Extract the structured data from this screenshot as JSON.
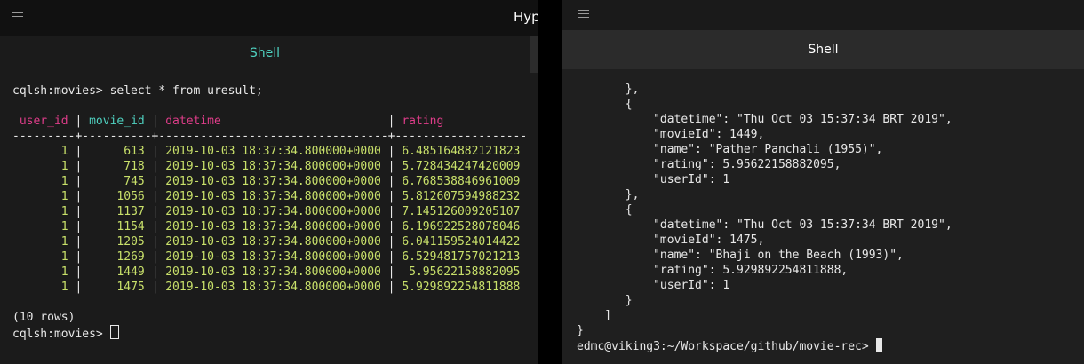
{
  "left_window": {
    "app_title": "Hype",
    "tab": "Shell",
    "prompt_command": "cqlsh:movies> select * from uresult;",
    "columns": [
      "user_id",
      "movie_id",
      "datetime",
      "rating"
    ],
    "rows": [
      {
        "user_id": "1",
        "movie_id": "613",
        "datetime": "2019-10-03 18:37:34.800000+0000",
        "rating": "6.485164882121823"
      },
      {
        "user_id": "1",
        "movie_id": "718",
        "datetime": "2019-10-03 18:37:34.800000+0000",
        "rating": "5.728434247420009"
      },
      {
        "user_id": "1",
        "movie_id": "745",
        "datetime": "2019-10-03 18:37:34.800000+0000",
        "rating": "6.768538846961009"
      },
      {
        "user_id": "1",
        "movie_id": "1056",
        "datetime": "2019-10-03 18:37:34.800000+0000",
        "rating": "5.812607594988232"
      },
      {
        "user_id": "1",
        "movie_id": "1137",
        "datetime": "2019-10-03 18:37:34.800000+0000",
        "rating": "7.145126009205107"
      },
      {
        "user_id": "1",
        "movie_id": "1154",
        "datetime": "2019-10-03 18:37:34.800000+0000",
        "rating": "6.196922528078046"
      },
      {
        "user_id": "1",
        "movie_id": "1205",
        "datetime": "2019-10-03 18:37:34.800000+0000",
        "rating": "6.041159524014422"
      },
      {
        "user_id": "1",
        "movie_id": "1269",
        "datetime": "2019-10-03 18:37:34.800000+0000",
        "rating": "6.529481757021213"
      },
      {
        "user_id": "1",
        "movie_id": "1449",
        "datetime": "2019-10-03 18:37:34.800000+0000",
        "rating": " 5.95622158882095"
      },
      {
        "user_id": "1",
        "movie_id": "1475",
        "datetime": "2019-10-03 18:37:34.800000+0000",
        "rating": "5.929892254811888"
      }
    ],
    "row_count": "(10 rows)",
    "prompt": "cqlsh:movies> "
  },
  "right_window": {
    "tab": "Shell",
    "lines": [
      "       },",
      "       {",
      "           \"datetime\": \"Thu Oct 03 15:37:34 BRT 2019\",",
      "           \"movieId\": 1449,",
      "           \"name\": \"Pather Panchali (1955)\",",
      "           \"rating\": 5.95622158882095,",
      "           \"userId\": 1",
      "       },",
      "       {",
      "           \"datetime\": \"Thu Oct 03 15:37:34 BRT 2019\",",
      "           \"movieId\": 1475,",
      "           \"name\": \"Bhaji on the Beach (1993)\",",
      "           \"rating\": 5.929892254811888,",
      "           \"userId\": 1",
      "       }",
      "    ]",
      "}"
    ],
    "prompt": "edmc@viking3:~/Workspace/github/movie-rec> "
  }
}
